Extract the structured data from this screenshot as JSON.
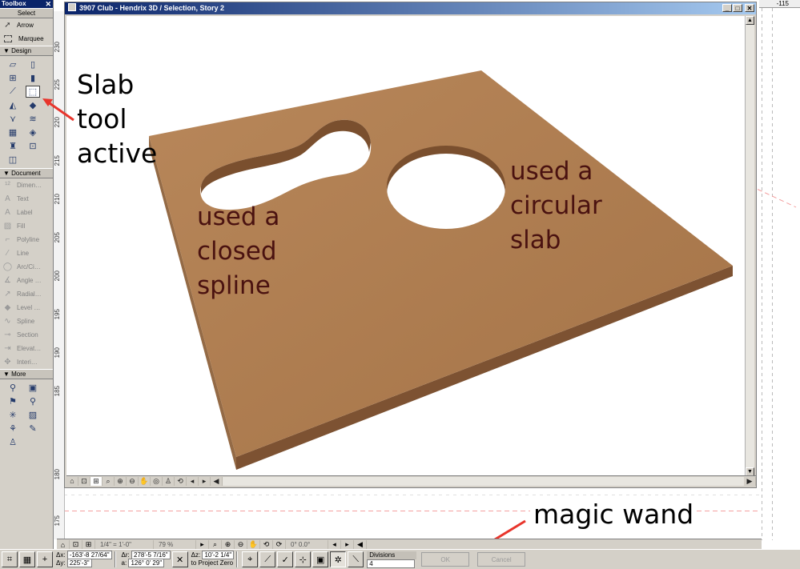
{
  "toolbox": {
    "title": "Toolbox",
    "close": "✕",
    "select_header": "Select",
    "select_items": [
      {
        "label": "Arrow",
        "icon": "arrow-pointer-icon"
      },
      {
        "label": "Marquee",
        "icon": "marquee-icon"
      }
    ],
    "design_header": "Design",
    "document_header": "Document",
    "document_items": [
      {
        "label": "Dimen…",
        "icon": "dimension-icon",
        "glyph": "¹²"
      },
      {
        "label": "Text",
        "icon": "text-icon",
        "glyph": "A"
      },
      {
        "label": "Label",
        "icon": "label-icon",
        "glyph": "A"
      },
      {
        "label": "Fill",
        "icon": "fill-icon",
        "glyph": "▨"
      },
      {
        "label": "Polyline",
        "icon": "polyline-icon",
        "glyph": "⌐"
      },
      {
        "label": "Line",
        "icon": "line-icon",
        "glyph": "⁄"
      },
      {
        "label": "Arc/Ci…",
        "icon": "arc-circle-icon",
        "glyph": "◯"
      },
      {
        "label": "Angle …",
        "icon": "angle-dimension-icon",
        "glyph": "∡"
      },
      {
        "label": "Radial…",
        "icon": "radial-dimension-icon",
        "glyph": "↗"
      },
      {
        "label": "Level …",
        "icon": "level-dimension-icon",
        "glyph": "◆"
      },
      {
        "label": "Spline",
        "icon": "spline-icon",
        "glyph": "∿"
      },
      {
        "label": "Section",
        "icon": "section-icon",
        "glyph": "⊸"
      },
      {
        "label": "Elevat…",
        "icon": "elevation-icon",
        "glyph": "⇥"
      },
      {
        "label": "Interi…",
        "icon": "interior-elevation-icon",
        "glyph": "✥"
      }
    ],
    "more_header": "More"
  },
  "window3d": {
    "title": "3907 Club - Hendrix 3D / Selection, Story 2"
  },
  "annotations": {
    "slab_tool": [
      "Slab",
      "tool",
      "active"
    ],
    "closed_spline": [
      "used a",
      "closed",
      "spline"
    ],
    "circular_slab": [
      "used a",
      "circular",
      "slab"
    ],
    "magic_wand": "magic wand"
  },
  "ruler": {
    "top_value": "-115",
    "labels": [
      "230",
      "225",
      "220",
      "215",
      "210",
      "205",
      "200",
      "195",
      "190",
      "185",
      "180",
      "175"
    ]
  },
  "planbar": {
    "scale": "1/4\" = 1'-0\"",
    "zoom": "79 %",
    "angle": "0° 0.0°"
  },
  "infobox": {
    "dx_label": "Δx:",
    "dx": "-163'-8 27/64\"",
    "dy_label": "Δy:",
    "dy": "225'-3\"",
    "dr_label": "Δr:",
    "dr": "278'-5 7/16\"",
    "a_label": "a:",
    "a": "126° 0' 29\"",
    "dz_label": "Δz:",
    "dz": "10'-2 1/4\"",
    "project_zero": "to Project Zero",
    "divisions_label": "Divisions",
    "divisions": "4",
    "ok": "OK",
    "cancel": "Cancel"
  },
  "colors": {
    "slab_top": "#ac7b4f",
    "slab_edge": "#8a5c38",
    "arrow": "#e8352c",
    "annotation_text": "#4a1210"
  }
}
